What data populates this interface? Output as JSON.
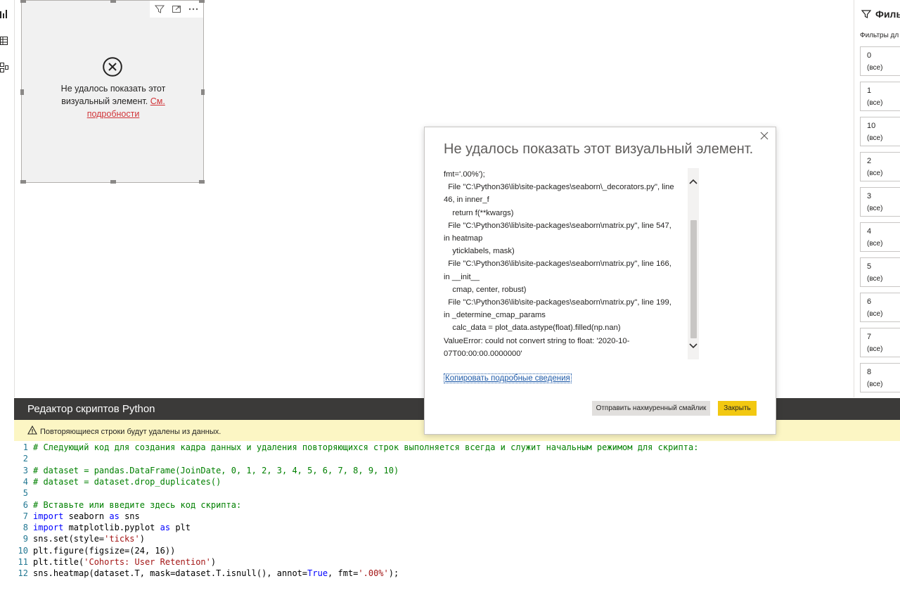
{
  "visual": {
    "error_text": "Не удалось показать этот визуальный элемент.",
    "error_link": "См. подробности"
  },
  "filters_pane": {
    "title": "Филь",
    "subtitle": "Фильтры дл",
    "cards": [
      {
        "name": "0",
        "value": "(все)"
      },
      {
        "name": "1",
        "value": "(все)"
      },
      {
        "name": "10",
        "value": "(все)"
      },
      {
        "name": "2",
        "value": "(все)"
      },
      {
        "name": "3",
        "value": "(все)"
      },
      {
        "name": "4",
        "value": "(все)"
      },
      {
        "name": "5",
        "value": "(все)"
      },
      {
        "name": "6",
        "value": "(все)"
      },
      {
        "name": "7",
        "value": "(все)"
      },
      {
        "name": "8",
        "value": "(все)"
      }
    ]
  },
  "dialog": {
    "title": "Не удалось показать этот визуальный элемент.",
    "error_lines": [
      "fmt='.00%');",
      "  File \"C:\\Python36\\lib\\site-packages\\seaborn\\_decorators.py\", line",
      "46, in inner_f",
      "    return f(**kwargs)",
      "  File \"C:\\Python36\\lib\\site-packages\\seaborn\\matrix.py\", line 547,",
      "in heatmap",
      "    yticklabels, mask)",
      "  File \"C:\\Python36\\lib\\site-packages\\seaborn\\matrix.py\", line 166,",
      "in __init__",
      "    cmap, center, robust)",
      "  File \"C:\\Python36\\lib\\site-packages\\seaborn\\matrix.py\", line 199,",
      "in _determine_cmap_params",
      "    calc_data = plot_data.astype(float).filled(np.nan)",
      "ValueError: could not convert string to float: '2020-10-",
      "07T00:00:00.0000000'"
    ],
    "copy_link": "Копировать подробные сведения",
    "frown_button": "Отправить нахмуренный смайлик",
    "close_button": "Закрыть"
  },
  "editor": {
    "title": "Редактор скриптов Python",
    "warning": "Повторяющиеся строки будут удалены из данных.",
    "lines": [
      {
        "n": "1",
        "parts": [
          {
            "t": "# Следующий код для создания кадра данных и удаления повторяющихся строк выполняется всегда и служит начальным режимом для скрипта:",
            "c": "com"
          }
        ]
      },
      {
        "n": "2",
        "parts": []
      },
      {
        "n": "3",
        "parts": [
          {
            "t": "# dataset = pandas.DataFrame(JoinDate, 0, 1, 2, 3, 4, 5, 6, 7, 8, 9, 10)",
            "c": "com"
          }
        ]
      },
      {
        "n": "4",
        "parts": [
          {
            "t": "# dataset = dataset.drop_duplicates()",
            "c": "com"
          }
        ]
      },
      {
        "n": "5",
        "parts": []
      },
      {
        "n": "6",
        "parts": [
          {
            "t": "# Вставьте или введите здесь код скрипта:",
            "c": "com"
          }
        ]
      },
      {
        "n": "7",
        "parts": [
          {
            "t": "import",
            "c": "kw"
          },
          {
            "t": " seaborn ",
            "c": "txt"
          },
          {
            "t": "as",
            "c": "kw"
          },
          {
            "t": " sns",
            "c": "txt"
          }
        ]
      },
      {
        "n": "8",
        "parts": [
          {
            "t": "import",
            "c": "kw"
          },
          {
            "t": " matplotlib.pyplot ",
            "c": "txt"
          },
          {
            "t": "as",
            "c": "kw"
          },
          {
            "t": " plt",
            "c": "txt"
          }
        ]
      },
      {
        "n": "9",
        "parts": [
          {
            "t": "sns.set(style=",
            "c": "txt"
          },
          {
            "t": "'ticks'",
            "c": "str"
          },
          {
            "t": ")",
            "c": "txt"
          }
        ]
      },
      {
        "n": "10",
        "parts": [
          {
            "t": "plt.figure(figsize=(24, 16))",
            "c": "txt"
          }
        ]
      },
      {
        "n": "11",
        "parts": [
          {
            "t": "plt.title(",
            "c": "txt"
          },
          {
            "t": "'Cohorts: User Retention'",
            "c": "str"
          },
          {
            "t": ")",
            "c": "txt"
          }
        ]
      },
      {
        "n": "12",
        "parts": [
          {
            "t": "sns.heatmap(dataset.T, mask=dataset.T.isnull(), annot=",
            "c": "txt"
          },
          {
            "t": "True",
            "c": "kw"
          },
          {
            "t": ", fmt=",
            "c": "txt"
          },
          {
            "t": "'.00%'",
            "c": "str"
          },
          {
            "t": ");",
            "c": "txt"
          }
        ]
      }
    ]
  }
}
